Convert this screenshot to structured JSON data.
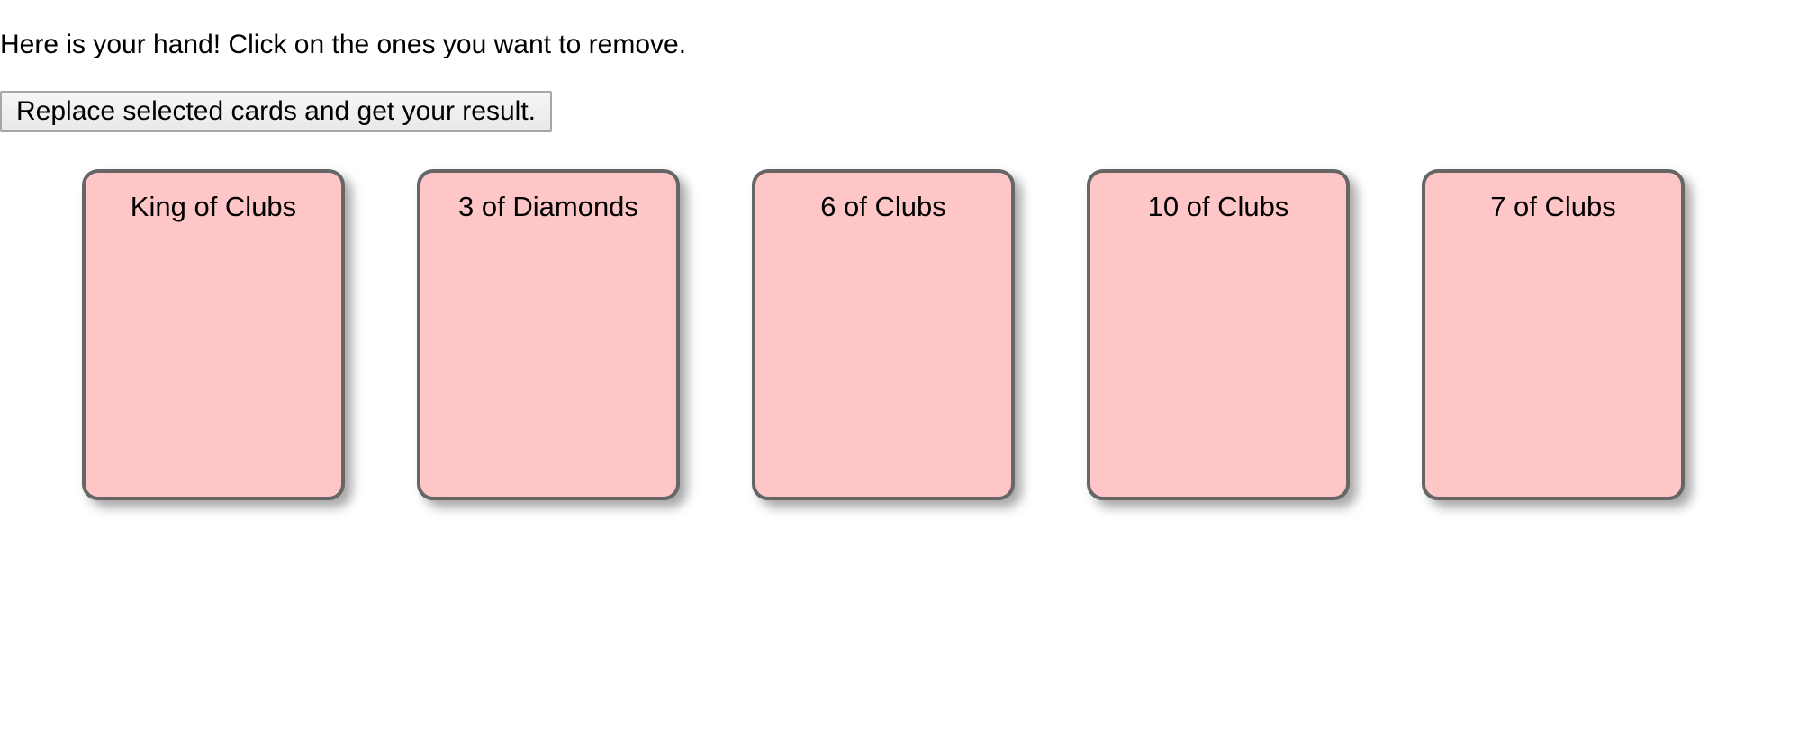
{
  "instructions": "Here is your hand! Click on the ones you want to remove.",
  "replace_button_label": "Replace selected cards and get your result.",
  "colors": {
    "card_background": "#fec6c6",
    "card_border": "#666666",
    "page_background": "#ffffff"
  },
  "hand": {
    "cards": [
      {
        "label": "King of Clubs"
      },
      {
        "label": "3 of Diamonds"
      },
      {
        "label": "6 of Clubs"
      },
      {
        "label": "10 of Clubs"
      },
      {
        "label": "7 of Clubs"
      }
    ]
  }
}
